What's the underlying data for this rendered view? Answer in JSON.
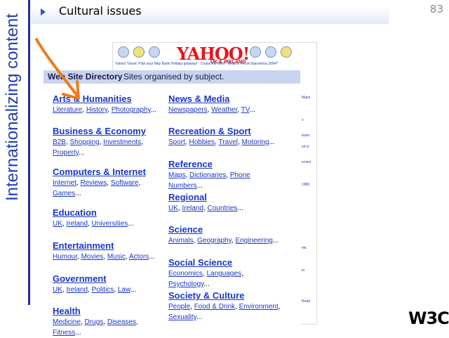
{
  "slide": {
    "number": "83",
    "side_title": "Internationalizing content",
    "heading": "Cultural issues"
  },
  "yahoo": {
    "logo": "YAHOO!",
    "edition": "UK & IRELAND",
    "links": "Yahoo! Travel: Plan your May Bank Holiday getaway! · Cruise the Med · What is Fórum Barcelona 2004?"
  },
  "directory": {
    "title": "Web Site Directory",
    "subtitle": "Sites organised by subject.",
    "left": [
      {
        "title": "Arts & Humanities",
        "subs": [
          "Literature",
          "History",
          "Photography"
        ]
      },
      {
        "title": "Business & Economy",
        "subs": [
          "B2B",
          "Shopping",
          "Investments",
          "Property"
        ]
      },
      {
        "title": "Computers & Internet",
        "subs": [
          "Internet",
          "Reviews",
          "Software",
          "Games"
        ]
      },
      {
        "title": "Education",
        "subs": [
          "UK",
          "Ireland",
          "Universities"
        ]
      },
      {
        "title": "Entertainment",
        "subs": [
          "Humour",
          "Movies",
          "Music",
          "Actors"
        ]
      },
      {
        "title": "Government",
        "subs": [
          "UK",
          "Ireland",
          "Politics",
          "Law"
        ]
      },
      {
        "title": "Health",
        "subs": [
          "Medicine",
          "Drugs",
          "Diseases",
          "Fitness"
        ]
      }
    ],
    "right": [
      {
        "title": "News & Media",
        "subs": [
          "Newspapers",
          "Weather",
          "TV"
        ]
      },
      {
        "title": "Recreation & Sport",
        "subs": [
          "Sport",
          "Hobbies",
          "Travel",
          "Motoring"
        ]
      },
      {
        "title": "Reference",
        "subs": [
          "Maps",
          "Dictionaries",
          "Phone Numbers"
        ]
      },
      {
        "title": "Regional",
        "subs": [
          "UK",
          "Ireland",
          "Countries"
        ]
      },
      {
        "title": "Science",
        "subs": [
          "Animals",
          "Geography",
          "Engineering"
        ]
      },
      {
        "title": "Social Science",
        "subs": [
          "Economics",
          "Languages",
          "Psychology"
        ]
      },
      {
        "title": "Society & Culture",
        "subs": [
          "People",
          "Food & Drink",
          "Environment",
          "Sexuality"
        ]
      }
    ]
  },
  "logo": {
    "text": "W3C",
    "mark": "®"
  },
  "colors": {
    "link": "#1a36c8",
    "arrow": "#f07a1a",
    "side_title": "#1f3fb0"
  }
}
